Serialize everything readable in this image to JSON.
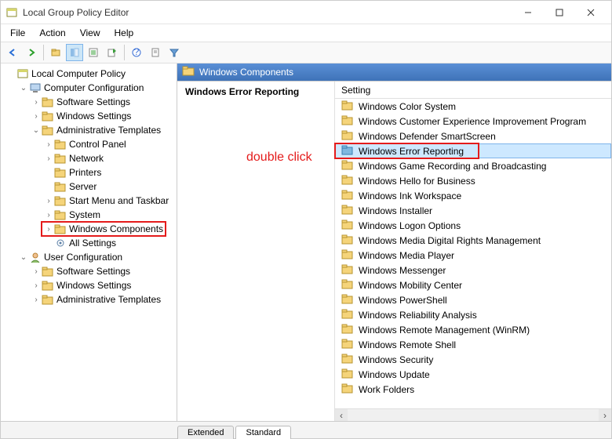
{
  "title": "Local Group Policy Editor",
  "menus": [
    "File",
    "Action",
    "View",
    "Help"
  ],
  "path_header": "Windows Components",
  "detail_heading": "Windows Error Reporting",
  "column_header": "Setting",
  "annotation": "double click",
  "tabs": {
    "extended": "Extended",
    "standard": "Standard"
  },
  "tree": [
    {
      "label": "Local Computer Policy",
      "depth": 0,
      "twisty": "",
      "icon": "policy"
    },
    {
      "label": "Computer Configuration",
      "depth": 1,
      "twisty": "v",
      "icon": "computer"
    },
    {
      "label": "Software Settings",
      "depth": 2,
      "twisty": ">",
      "icon": "folder"
    },
    {
      "label": "Windows Settings",
      "depth": 2,
      "twisty": ">",
      "icon": "folder"
    },
    {
      "label": "Administrative Templates",
      "depth": 2,
      "twisty": "v",
      "icon": "folder"
    },
    {
      "label": "Control Panel",
      "depth": 3,
      "twisty": ">",
      "icon": "folder"
    },
    {
      "label": "Network",
      "depth": 3,
      "twisty": ">",
      "icon": "folder"
    },
    {
      "label": "Printers",
      "depth": 3,
      "twisty": "",
      "icon": "folder"
    },
    {
      "label": "Server",
      "depth": 3,
      "twisty": "",
      "icon": "folder"
    },
    {
      "label": "Start Menu and Taskbar",
      "depth": 3,
      "twisty": ">",
      "icon": "folder"
    },
    {
      "label": "System",
      "depth": 3,
      "twisty": ">",
      "icon": "folder"
    },
    {
      "label": "Windows Components",
      "depth": 3,
      "twisty": ">",
      "icon": "folder",
      "boxed": true
    },
    {
      "label": "All Settings",
      "depth": 3,
      "twisty": "",
      "icon": "settings"
    },
    {
      "label": "User Configuration",
      "depth": 1,
      "twisty": "v",
      "icon": "user"
    },
    {
      "label": "Software Settings",
      "depth": 2,
      "twisty": ">",
      "icon": "folder"
    },
    {
      "label": "Windows Settings",
      "depth": 2,
      "twisty": ">",
      "icon": "folder"
    },
    {
      "label": "Administrative Templates",
      "depth": 2,
      "twisty": ">",
      "icon": "folder"
    }
  ],
  "settings": [
    {
      "label": "Windows Color System"
    },
    {
      "label": "Windows Customer Experience Improvement Program"
    },
    {
      "label": "Windows Defender SmartScreen"
    },
    {
      "label": "Windows Error Reporting",
      "highlighted": true,
      "boxed": true
    },
    {
      "label": "Windows Game Recording and Broadcasting"
    },
    {
      "label": "Windows Hello for Business"
    },
    {
      "label": "Windows Ink Workspace"
    },
    {
      "label": "Windows Installer"
    },
    {
      "label": "Windows Logon Options"
    },
    {
      "label": "Windows Media Digital Rights Management"
    },
    {
      "label": "Windows Media Player"
    },
    {
      "label": "Windows Messenger"
    },
    {
      "label": "Windows Mobility Center"
    },
    {
      "label": "Windows PowerShell"
    },
    {
      "label": "Windows Reliability Analysis"
    },
    {
      "label": "Windows Remote Management (WinRM)"
    },
    {
      "label": "Windows Remote Shell"
    },
    {
      "label": "Windows Security"
    },
    {
      "label": "Windows Update"
    },
    {
      "label": "Work Folders"
    }
  ]
}
